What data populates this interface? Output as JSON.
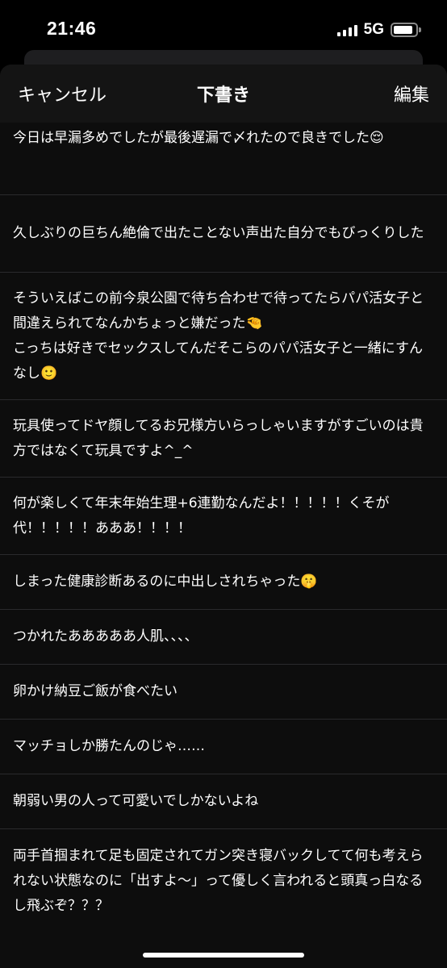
{
  "status_bar": {
    "time": "21:46",
    "network": "5G",
    "battery_level": 0.9,
    "signal_bars": 4
  },
  "nav": {
    "cancel_label": "キャンセル",
    "title": "下書き",
    "edit_label": "編集"
  },
  "drafts": [
    {
      "text": "今日は早漏多めでしたが最後遅漏で〆れたので良きでした😌"
    },
    {
      "text": "久しぶりの巨ちん絶倫で出たことない声出た自分でもびっくりした"
    },
    {
      "text": "そういえばこの前今泉公園で待ち合わせで待ってたらパパ活女子と間違えられてなんかちょっと嫌だった🤏\nこっちは好きでセックスしてんだそこらのパパ活女子と一緒にすんなし🙂"
    },
    {
      "text": "玩具使ってドヤ顔してるお兄様方いらっしゃいますがすごいのは貴方ではなくて玩具ですよ^_^"
    },
    {
      "text": "何が楽しくて年末年始生理+6連勤なんだよ！！！！！くそが代！！！！！あああ！！！！"
    },
    {
      "text": "しまった健康診断あるのに中出しされちゃった🤫"
    },
    {
      "text": "つかれたあああああ人肌、、、、"
    },
    {
      "text": "卵かけ納豆ご飯が食べたい"
    },
    {
      "text": "マッチョしか勝たんのじゃ……"
    },
    {
      "text": "朝弱い男の人って可愛いでしかないよね"
    },
    {
      "text": "両手首掴まれて足も固定されてガン突き寝バックしてて何も考えられない状態なのに「出すよ〜」って優しく言われると頭真っ白なるし飛ぶぞ？？？"
    }
  ],
  "colors": {
    "background": "#000000",
    "sheet": "#0d0d0d",
    "nav_bar": "#141414",
    "separator": "#2a2a2c",
    "text": "#ffffff"
  }
}
